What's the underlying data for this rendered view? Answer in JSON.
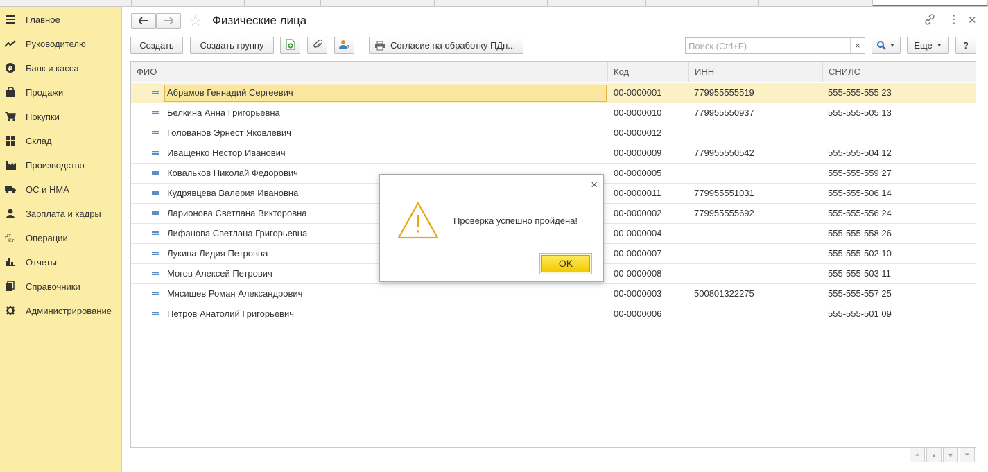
{
  "sidebar": {
    "items": [
      {
        "label": "Главное",
        "icon": "menu-icon"
      },
      {
        "label": "Руководителю",
        "icon": "trend-icon"
      },
      {
        "label": "Банк и касса",
        "icon": "ruble-coin-icon"
      },
      {
        "label": "Продажи",
        "icon": "shopping-bag-icon"
      },
      {
        "label": "Покупки",
        "icon": "cart-icon"
      },
      {
        "label": "Склад",
        "icon": "warehouse-grid-icon"
      },
      {
        "label": "Производство",
        "icon": "factory-icon"
      },
      {
        "label": "ОС и НМА",
        "icon": "truck-icon"
      },
      {
        "label": "Зарплата и кадры",
        "icon": "person-icon"
      },
      {
        "label": "Операции",
        "icon": "dt-kt-icon"
      },
      {
        "label": "Отчеты",
        "icon": "bar-chart-icon"
      },
      {
        "label": "Справочники",
        "icon": "books-icon"
      },
      {
        "label": "Администрирование",
        "icon": "gear-icon"
      }
    ],
    "dtkt": {
      "top": "Дт",
      "bottom": "Кт"
    }
  },
  "header": {
    "title": "Физические лица",
    "back_icon": "arrow-left-icon",
    "forward_icon": "arrow-right-icon",
    "favorite_icon": "star-icon"
  },
  "toolbar": {
    "create_label": "Создать",
    "create_group_label": "Создать группу",
    "consent_label": "Согласие на обработку ПДн...",
    "search_placeholder": "Поиск (Ctrl+F)",
    "search_clear": "×",
    "more_label": "Еще",
    "help_label": "?"
  },
  "table": {
    "columns": [
      "ФИО",
      "Код",
      "ИНН",
      "СНИЛС"
    ],
    "rows": [
      {
        "fio": "Абрамов Геннадий Сергеевич",
        "code": "00-0000001",
        "inn": "779955555519",
        "snils": "555-555-555 23"
      },
      {
        "fio": "Белкина Анна Григорьевна",
        "code": "00-0000010",
        "inn": "779955550937",
        "snils": "555-555-505 13"
      },
      {
        "fio": "Голованов Эрнест Яковлевич",
        "code": "00-0000012",
        "inn": "",
        "snils": ""
      },
      {
        "fio": "Иващенко Нестор Иванович",
        "code": "00-0000009",
        "inn": "779955550542",
        "snils": "555-555-504 12"
      },
      {
        "fio": "Ковальков Николай Федорович",
        "code": "00-0000005",
        "inn": "",
        "snils": "555-555-559 27"
      },
      {
        "fio": "Кудрявцева Валерия Ивановна",
        "code": "00-0000011",
        "inn": "779955551031",
        "snils": "555-555-506 14"
      },
      {
        "fio": "Ларионова Светлана Викторовна",
        "code": "00-0000002",
        "inn": "779955555692",
        "snils": "555-555-556 24"
      },
      {
        "fio": "Лифанова Светлана Григорьевна",
        "code": "00-0000004",
        "inn": "",
        "snils": "555-555-558 26"
      },
      {
        "fio": "Лукина Лидия Петровна",
        "code": "00-0000007",
        "inn": "",
        "snils": "555-555-502 10"
      },
      {
        "fio": "Могов Алексей Петрович",
        "code": "00-0000008",
        "inn": "",
        "snils": "555-555-503 11"
      },
      {
        "fio": "Мясищев Роман Александрович",
        "code": "00-0000003",
        "inn": "500801322275",
        "snils": "555-555-557 25"
      },
      {
        "fio": "Петров Анатолий Григорьевич",
        "code": "00-0000006",
        "inn": "",
        "snils": "555-555-501 09"
      }
    ]
  },
  "dialog": {
    "message": "Проверка успешно пройдена!",
    "ok_label": "OK",
    "close_label": "×"
  },
  "colors": {
    "sidebar_bg": "#fbeca6",
    "selected_row": "#fbf1c5",
    "ok_button": "#f3c900",
    "warning": "#e8a317"
  }
}
